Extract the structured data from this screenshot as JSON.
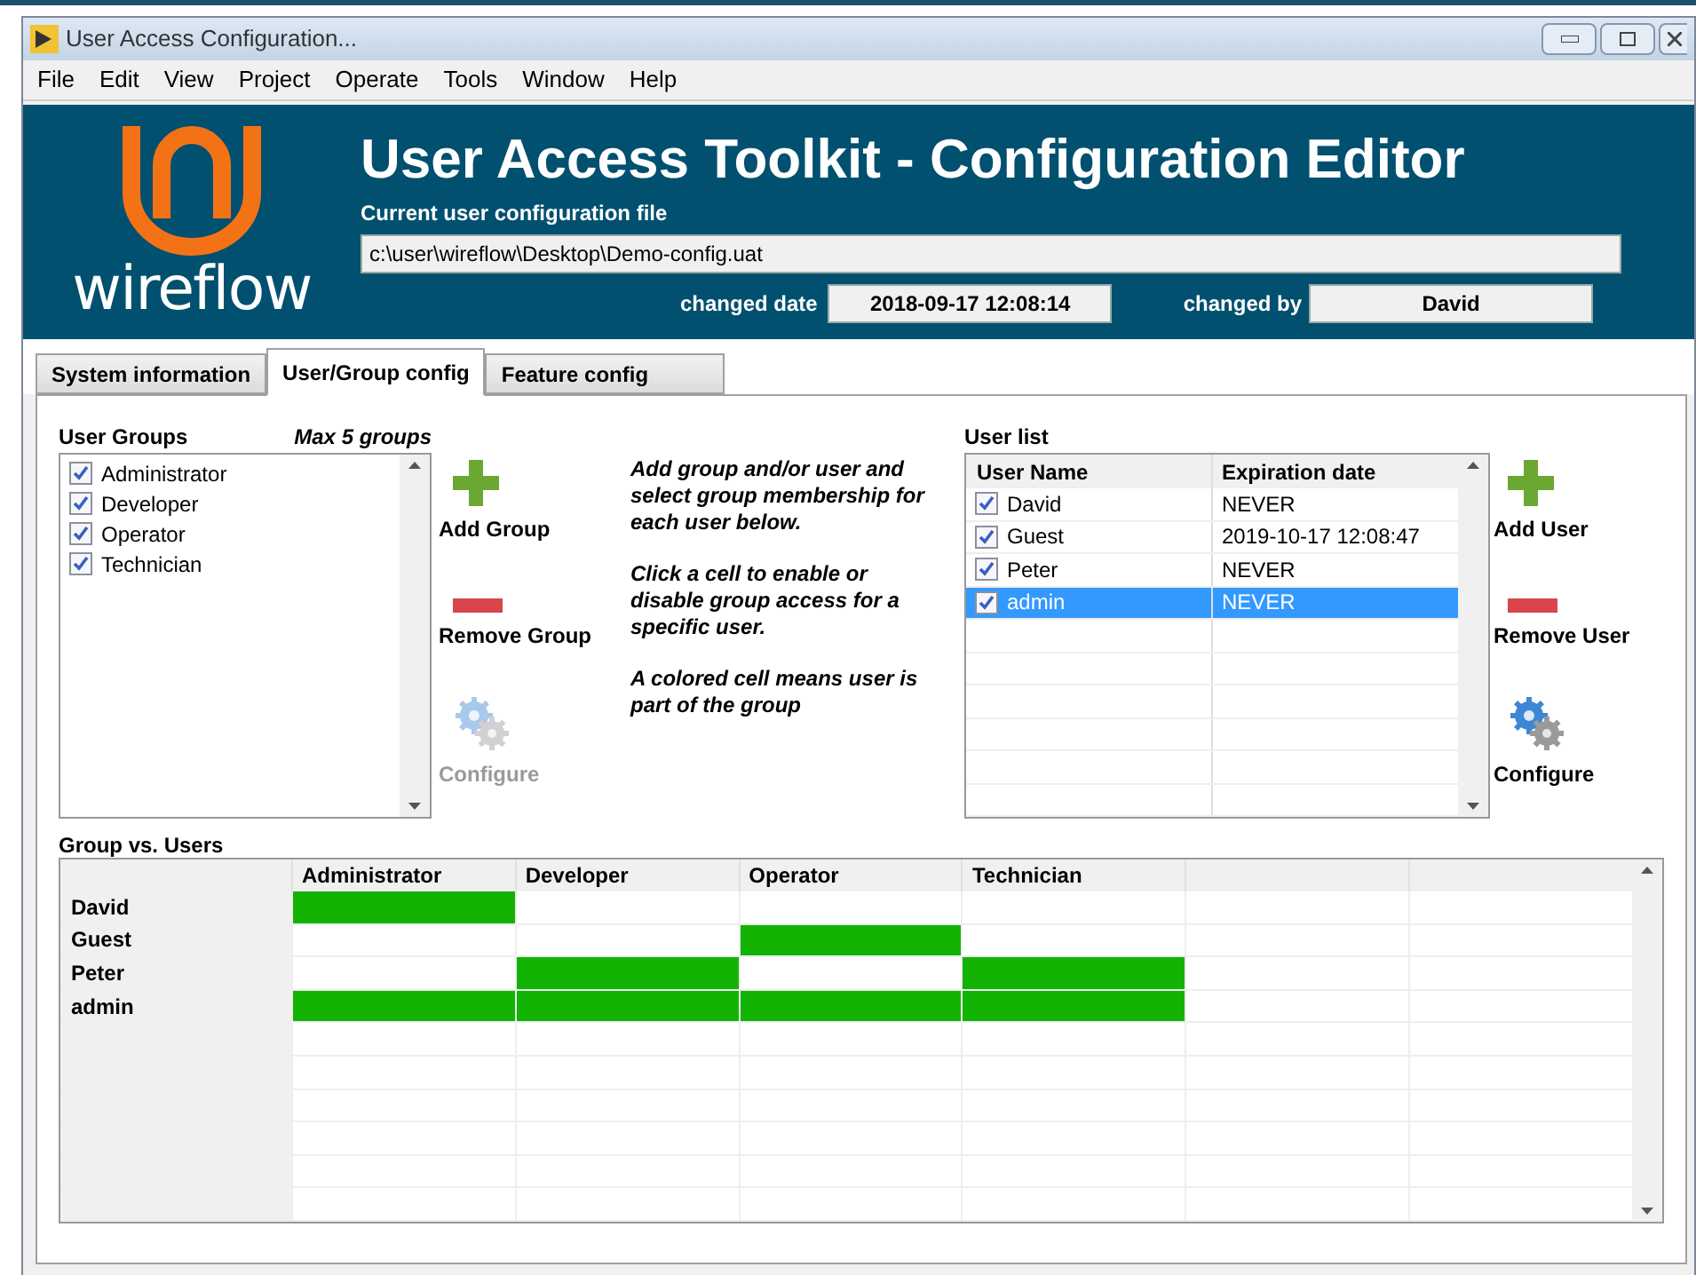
{
  "window": {
    "title": "User Access Configuration..."
  },
  "menu": [
    "File",
    "Edit",
    "View",
    "Project",
    "Operate",
    "Tools",
    "Window",
    "Help"
  ],
  "header": {
    "logo_text": "wireflow",
    "title": "User Access Toolkit - Configuration Editor",
    "file_label": "Current user configuration file",
    "file_path": "c:\\user\\wireflow\\Desktop\\Demo-config.uat",
    "changed_date_label": "changed date",
    "changed_date": "2018-09-17 12:08:14",
    "changed_by_label": "changed by",
    "changed_by": "David"
  },
  "tabs": [
    {
      "label": "System information",
      "selected": false
    },
    {
      "label": "User/Group config",
      "selected": true
    },
    {
      "label": "Feature config",
      "selected": false
    }
  ],
  "user_groups": {
    "label": "User Groups",
    "note": "Max 5 groups",
    "items": [
      {
        "label": "Administrator",
        "checked": true
      },
      {
        "label": "Developer",
        "checked": true
      },
      {
        "label": "Operator",
        "checked": true
      },
      {
        "label": "Technician",
        "checked": true
      }
    ]
  },
  "group_buttons": [
    {
      "kind": "add",
      "label": "Add Group",
      "disabled": false
    },
    {
      "kind": "remove",
      "label": "Remove Group",
      "disabled": false
    },
    {
      "kind": "configure",
      "label": "Configure",
      "disabled": true
    }
  ],
  "instructions": [
    "Add group and/or user and select group membership for each user below.",
    "Click a cell to enable or disable group access for a specific user.",
    "A colored cell means user is part of the group"
  ],
  "user_list": {
    "label": "User list",
    "columns": [
      "User Name",
      "Expiration date"
    ],
    "rows": [
      {
        "name": "David",
        "expiration": "NEVER",
        "checked": true,
        "selected": false
      },
      {
        "name": "Guest",
        "expiration": "2019-10-17 12:08:47",
        "checked": true,
        "selected": false
      },
      {
        "name": "Peter",
        "expiration": "NEVER",
        "checked": true,
        "selected": false
      },
      {
        "name": "admin",
        "expiration": "NEVER",
        "checked": true,
        "selected": true
      }
    ]
  },
  "user_buttons": [
    {
      "kind": "add",
      "label": "Add User",
      "disabled": false
    },
    {
      "kind": "remove",
      "label": "Remove User",
      "disabled": false
    },
    {
      "kind": "configure",
      "label": "Configure",
      "disabled": false
    }
  ],
  "matrix": {
    "label": "Group vs. Users",
    "columns": [
      "Administrator",
      "Developer",
      "Operator",
      "Technician"
    ],
    "rows": [
      {
        "name": "David",
        "cells": [
          true,
          false,
          false,
          false
        ]
      },
      {
        "name": "Guest",
        "cells": [
          false,
          false,
          true,
          false
        ]
      },
      {
        "name": "Peter",
        "cells": [
          false,
          true,
          false,
          true
        ]
      },
      {
        "name": "admin",
        "cells": [
          true,
          true,
          true,
          true
        ]
      }
    ]
  }
}
